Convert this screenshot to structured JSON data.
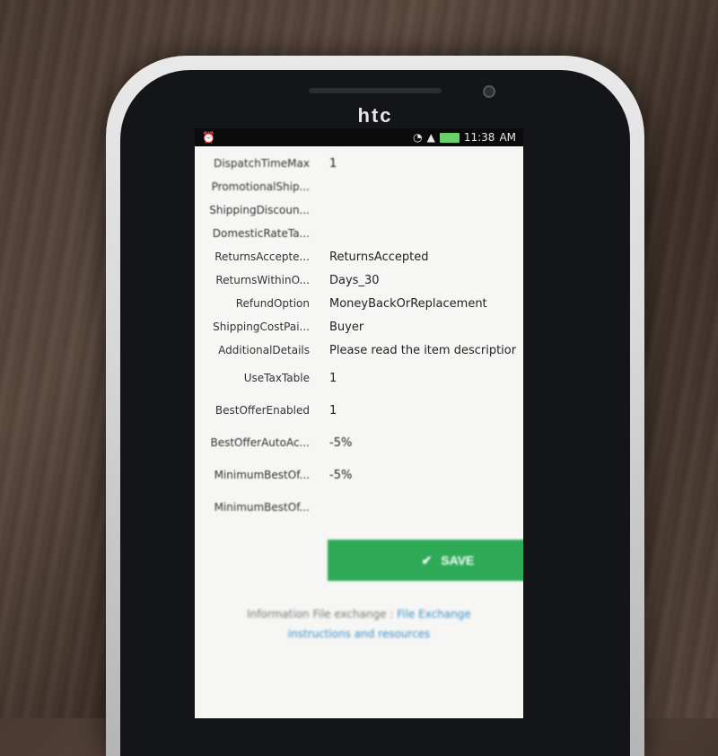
{
  "device": {
    "brand": "htc"
  },
  "statusbar": {
    "time": "11:38",
    "am_pm": "AM"
  },
  "form": {
    "rows": [
      {
        "label": "DispatchTimeMax",
        "value": "1"
      },
      {
        "label": "PromotionalShip...",
        "value": ""
      },
      {
        "label": "ShippingDiscoun...",
        "value": ""
      },
      {
        "label": "DomesticRateTa...",
        "value": ""
      },
      {
        "label": "ReturnsAccepte...",
        "value": "ReturnsAccepted"
      },
      {
        "label": "ReturnsWithinO...",
        "value": "Days_30"
      },
      {
        "label": "RefundOption",
        "value": "MoneyBackOrReplacement"
      },
      {
        "label": "ShippingCostPai...",
        "value": "Buyer"
      },
      {
        "label": "AdditionalDetails",
        "value": "Please read the item descriptior"
      },
      {
        "label": "UseTaxTable",
        "value": "1"
      },
      {
        "label": "BestOfferEnabled",
        "value": "1"
      },
      {
        "label": "BestOfferAutoAc...",
        "value": "-5%"
      },
      {
        "label": "MinimumBestOf...",
        "value": "-5%"
      },
      {
        "label": "MinimumBestOf...",
        "value": ""
      }
    ]
  },
  "save_button": {
    "label": "SAVE"
  },
  "footer": {
    "text": "Information File exchange :",
    "link1": "File Exchange",
    "link2": "instructions and resources"
  },
  "colors": {
    "save": "#2eaa57",
    "link": "#3a8fc8"
  }
}
